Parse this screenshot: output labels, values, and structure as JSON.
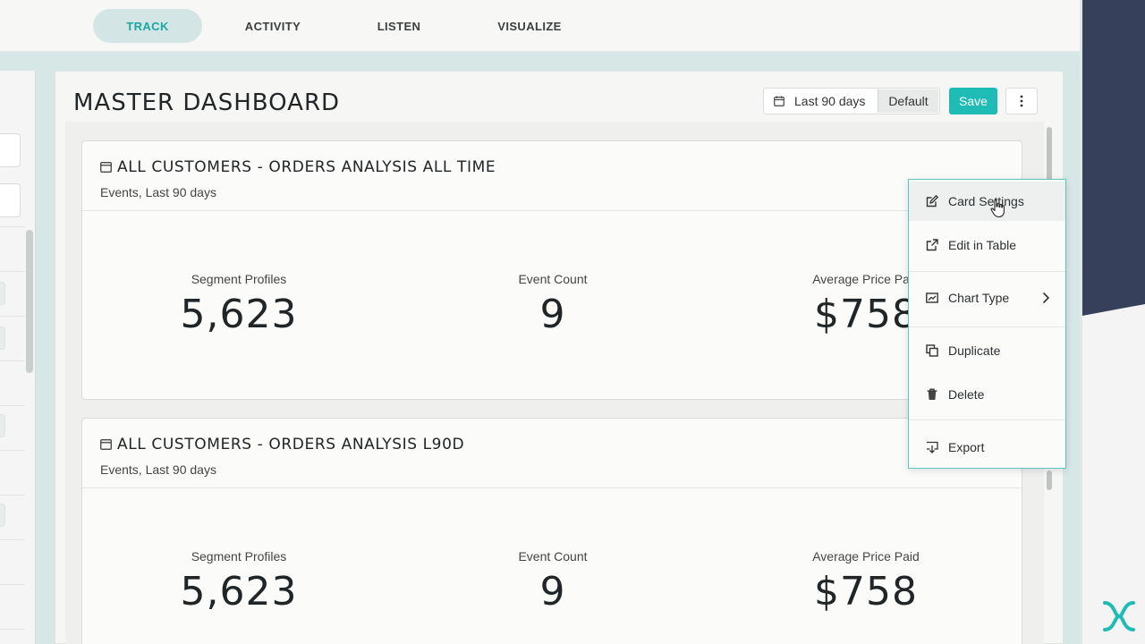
{
  "nav": {
    "tabs": [
      {
        "label": "TRACK",
        "active": true
      },
      {
        "label": "ACTIVITY",
        "active": false
      },
      {
        "label": "LISTEN",
        "active": false
      },
      {
        "label": "VISUALIZE",
        "active": false
      }
    ]
  },
  "dashboard": {
    "title": "MASTER DASHBOARD",
    "date_range": "Last 90 days",
    "default_label": "Default",
    "save_label": "Save",
    "more_icon": "kebab-icon"
  },
  "cards": [
    {
      "title": "ALL CUSTOMERS - ORDERS ANALYSIS ALL TIME",
      "subtitle": "Events, Last 90 days",
      "metrics": [
        {
          "label": "Segment Profiles",
          "value": "5,623"
        },
        {
          "label": "Event Count",
          "value": "9"
        },
        {
          "label": "Average Price Paid",
          "value": "$758"
        }
      ]
    },
    {
      "title": "ALL CUSTOMERS - ORDERS ANALYSIS L90D",
      "subtitle": "Events, Last 90 days",
      "metrics": [
        {
          "label": "Segment Profiles",
          "value": "5,623"
        },
        {
          "label": "Event Count",
          "value": "9"
        },
        {
          "label": "Average Price Paid",
          "value": "$758"
        }
      ]
    }
  ],
  "menu": {
    "items": [
      {
        "label": "Card Settings",
        "icon": "edit-icon"
      },
      {
        "label": "Edit in Table",
        "icon": "external-link-icon"
      },
      {
        "label": "Chart Type",
        "icon": "chart-icon"
      },
      {
        "label": "Duplicate",
        "icon": "copy-icon"
      },
      {
        "label": "Delete",
        "icon": "trash-icon"
      },
      {
        "label": "Export",
        "icon": "export-icon"
      }
    ]
  },
  "colors": {
    "accent": "#1fbcb5",
    "nav_active_bg": "#d3e6e5",
    "backdrop_dark": "#36405a"
  }
}
